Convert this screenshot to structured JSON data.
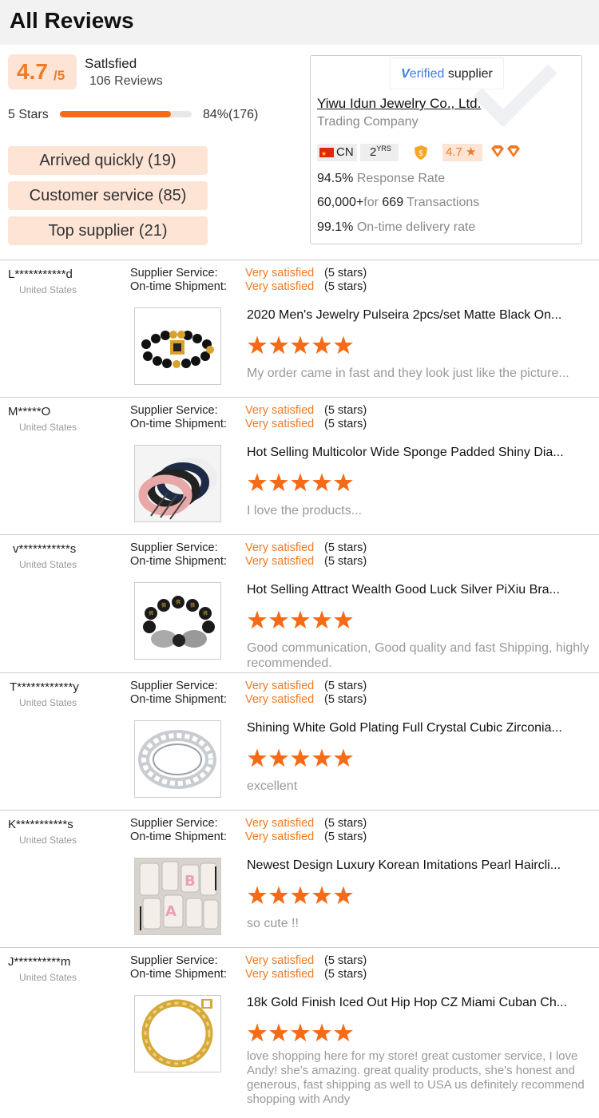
{
  "header": {
    "title": "All Reviews"
  },
  "summary": {
    "score": "4.7",
    "score_suffix": "/5",
    "satisfaction_label": "Satlsfied",
    "review_count": "106 Reviews",
    "stars_label": "5 Stars",
    "bar_fill_fraction": 0.84,
    "bar_percent_text": "84%(176)",
    "tags": [
      "Arrived quickly (19)",
      "Customer service (85)",
      "Top supplier (21)"
    ]
  },
  "supplier": {
    "verified_v": "V",
    "verified_rest": "erified",
    "verified_suffix": "supplier",
    "company_name": "Yiwu Idun Jewelry Co., Ltd.",
    "company_type": "Trading Company",
    "country": "CN",
    "years": "2",
    "years_unit": "YRS",
    "rating": "4.7 ★",
    "response_rate_value": "94.5%",
    "response_rate_label": "Response Rate",
    "transactions_prefix": "60,000+",
    "transactions_for": "for",
    "transactions_value": "669",
    "transactions_label": "Transactions",
    "ontime_value": "99.1%",
    "ontime_label": "On-time delivery rate"
  },
  "labels": {
    "supplier_service": "Supplier Service:",
    "ontime_shipment": "On-time Shipment:"
  },
  "colors": {
    "accent": "#f07a23",
    "tag_bg": "#fde4d5",
    "star": "#f76b16"
  },
  "reviews": [
    {
      "reviewer": "L***********d",
      "country": "United States",
      "supplier_service": "Very satisfied",
      "supplier_service_stars": "(5 stars)",
      "shipment": "Very satisfied",
      "shipment_stars": "(5 stars)",
      "product_title": "2020 Men's Jewelry Pulseira 2pcs/set Matte Black On...",
      "rating": 5,
      "comment": "My order came in fast and they look just like the picture..."
    },
    {
      "reviewer": "M*****O",
      "country": "United States",
      "supplier_service": "Very satisfied",
      "supplier_service_stars": "(5 stars)",
      "shipment": "Very satisfied",
      "shipment_stars": "(5 stars)",
      "product_title": "Hot Selling Multicolor Wide Sponge Padded Shiny Dia...",
      "rating": 5,
      "comment": "I love the products..."
    },
    {
      "reviewer": "v***********s",
      "country": "United States",
      "supplier_service": "Very satisfied",
      "supplier_service_stars": "(5 stars)",
      "shipment": "Very satisfied",
      "shipment_stars": "(5 stars)",
      "product_title": "Hot Selling Attract Wealth Good Luck Silver PiXiu Bra...",
      "rating": 5,
      "comment": "Good communication, Good quality and fast Shipping, highly recommended."
    },
    {
      "reviewer": "T************y",
      "country": "United States",
      "supplier_service": "Very satisfied",
      "supplier_service_stars": "(5 stars)",
      "shipment": "Very satisfied",
      "shipment_stars": "(5 stars)",
      "product_title": "Shining White Gold Plating Full Crystal Cubic Zirconia...",
      "rating": 5,
      "comment": "excellent"
    },
    {
      "reviewer": "K***********s",
      "country": "United States",
      "supplier_service": "Very satisfied",
      "supplier_service_stars": "(5 stars)",
      "shipment": "Very satisfied",
      "shipment_stars": "(5 stars)",
      "product_title": "Newest Design Luxury Korean Imitations Pearl Haircli...",
      "rating": 5,
      "comment": "so cute !!"
    },
    {
      "reviewer": "J**********m",
      "country": "United States",
      "supplier_service": "Very satisfied",
      "supplier_service_stars": "(5 stars)",
      "shipment": "Very satisfied",
      "shipment_stars": "(5 stars)",
      "product_title": "18k Gold Finish Iced Out Hip Hop CZ Miami Cuban Ch...",
      "rating": 5,
      "comment": "love shopping here for my store! great customer service, I love Andy! she's amazing. great quality products, she's honest and generous, fast shipping as well to USA us definitely recommend shopping with Andy"
    }
  ]
}
